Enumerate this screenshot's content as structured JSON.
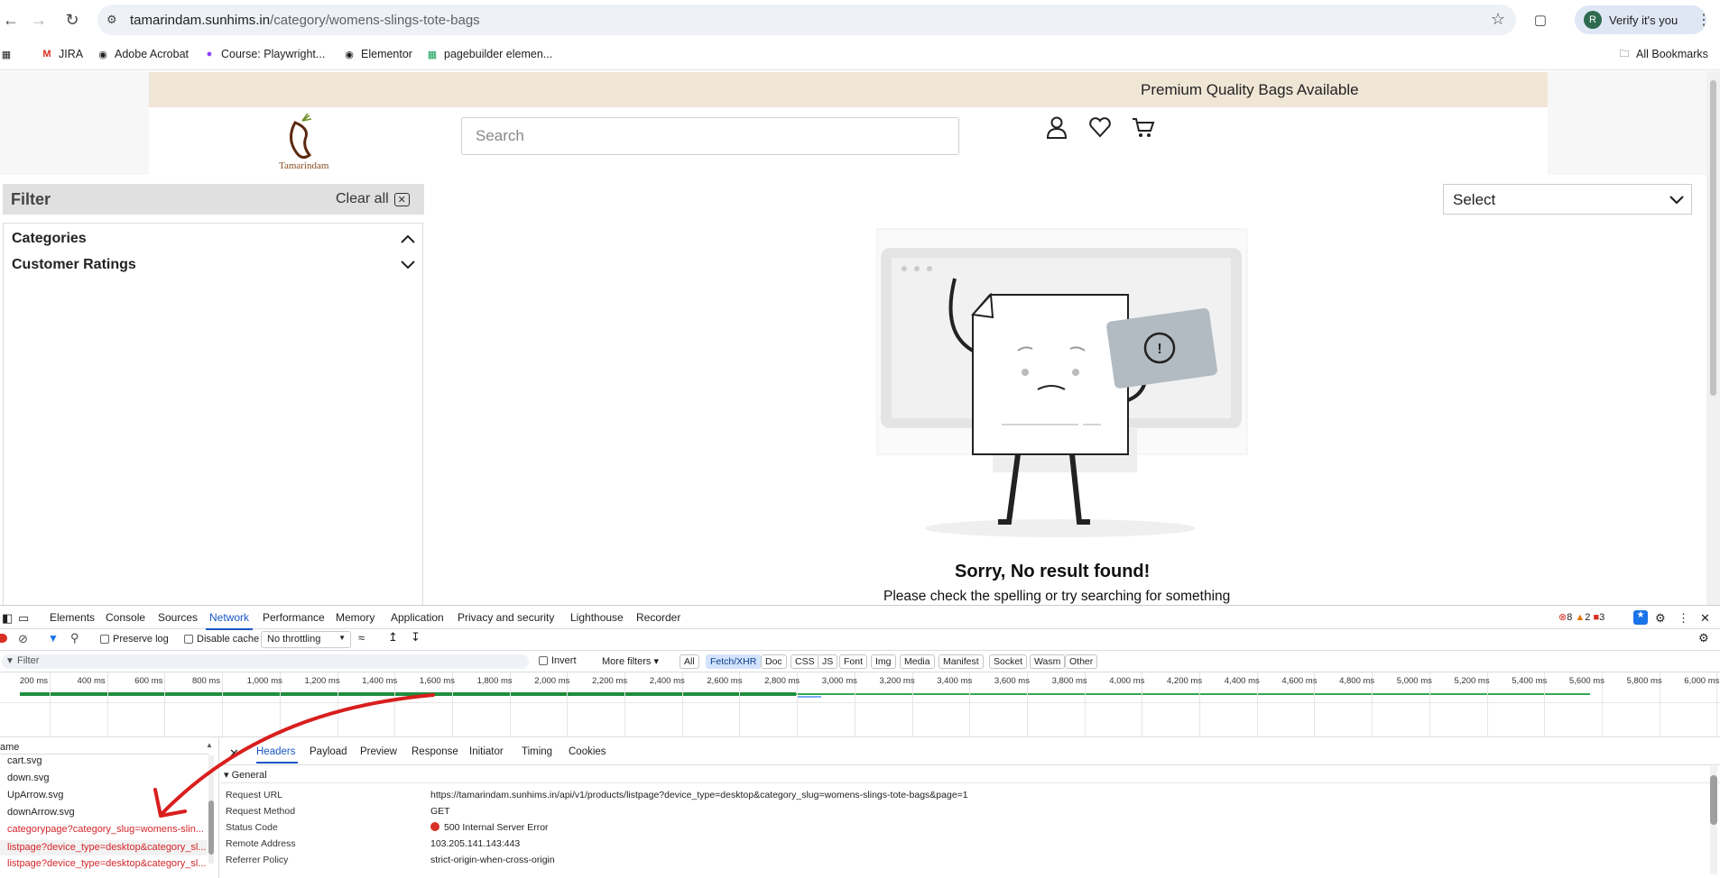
{
  "browser": {
    "url_domain": "tamarindam.sunhims.in",
    "url_path": "/category/womens-slings-tote-bags",
    "profile_button": "Verify it's you",
    "profile_initial": "R",
    "bookmarks": [
      "JIRA",
      "Adobe Acrobat",
      "Course: Playwright...",
      "Elementor",
      "pagebuilder elemen..."
    ],
    "all_bookmarks": "All Bookmarks"
  },
  "site": {
    "promo": "Premium Quality Bags Available",
    "logo_text": "Tamarindam",
    "search_placeholder": "Search",
    "filter_title": "Filter",
    "clear_all": "Clear all",
    "facets": [
      "Categories",
      "Customer Ratings"
    ],
    "sort_label": "Select",
    "empty_title": "Sorry, No result found!",
    "empty_subtitle": "Please check the spelling or try searching for something"
  },
  "devtools": {
    "tabs": [
      "Elements",
      "Console",
      "Sources",
      "Network",
      "Performance",
      "Memory",
      "Application",
      "Privacy and security",
      "Lighthouse",
      "Recorder"
    ],
    "active_tab": "Network",
    "counts": {
      "errors": "8",
      "warnings": "2",
      "issues": "3"
    },
    "preserve_log": "Preserve log",
    "disable_cache": "Disable cache",
    "throttling": "No throttling",
    "filter_placeholder": "Filter",
    "invert": "Invert",
    "more_filters": "More filters",
    "type_filters": [
      "All",
      "Fetch/XHR",
      "Doc",
      "CSS",
      "JS",
      "Font",
      "Img",
      "Media",
      "Manifest",
      "Socket",
      "Wasm",
      "Other"
    ],
    "active_type": "Fetch/XHR",
    "ticks": [
      "200 ms",
      "400 ms",
      "600 ms",
      "800 ms",
      "1,000 ms",
      "1,200 ms",
      "1,400 ms",
      "1,600 ms",
      "1,800 ms",
      "2,000 ms",
      "2,200 ms",
      "2,400 ms",
      "2,600 ms",
      "2,800 ms",
      "3,000 ms",
      "3,200 ms",
      "3,400 ms",
      "3,600 ms",
      "3,800 ms",
      "4,000 ms",
      "4,200 ms",
      "4,400 ms",
      "4,600 ms",
      "4,800 ms",
      "5,000 ms",
      "5,200 ms",
      "5,400 ms",
      "5,600 ms",
      "5,800 ms",
      "6,000 ms"
    ],
    "name_header": "ame",
    "requests": [
      {
        "name": "cart.svg",
        "error": false
      },
      {
        "name": "down.svg",
        "error": false
      },
      {
        "name": "UpArrow.svg",
        "error": false
      },
      {
        "name": "downArrow.svg",
        "error": false
      },
      {
        "name": "categorypage?category_slug=womens-slin...",
        "error": true
      },
      {
        "name": "listpage?device_type=desktop&category_sl...",
        "error": true
      },
      {
        "name": "listpage?device_type=desktop&category_sl...",
        "error": true
      }
    ],
    "detail_tabs": [
      "Headers",
      "Payload",
      "Preview",
      "Response",
      "Initiator",
      "Timing",
      "Cookies"
    ],
    "general_label": "General",
    "general": [
      {
        "key": "Request URL",
        "value": "https://tamarindam.sunhims.in/api/v1/products/listpage?device_type=desktop&category_slug=womens-slings-tote-bags&page=1"
      },
      {
        "key": "Request Method",
        "value": "GET"
      },
      {
        "key": "Status Code",
        "value": "500 Internal Server Error"
      },
      {
        "key": "Remote Address",
        "value": "103.205.141.143:443"
      },
      {
        "key": "Referrer Policy",
        "value": "strict-origin-when-cross-origin"
      }
    ]
  }
}
